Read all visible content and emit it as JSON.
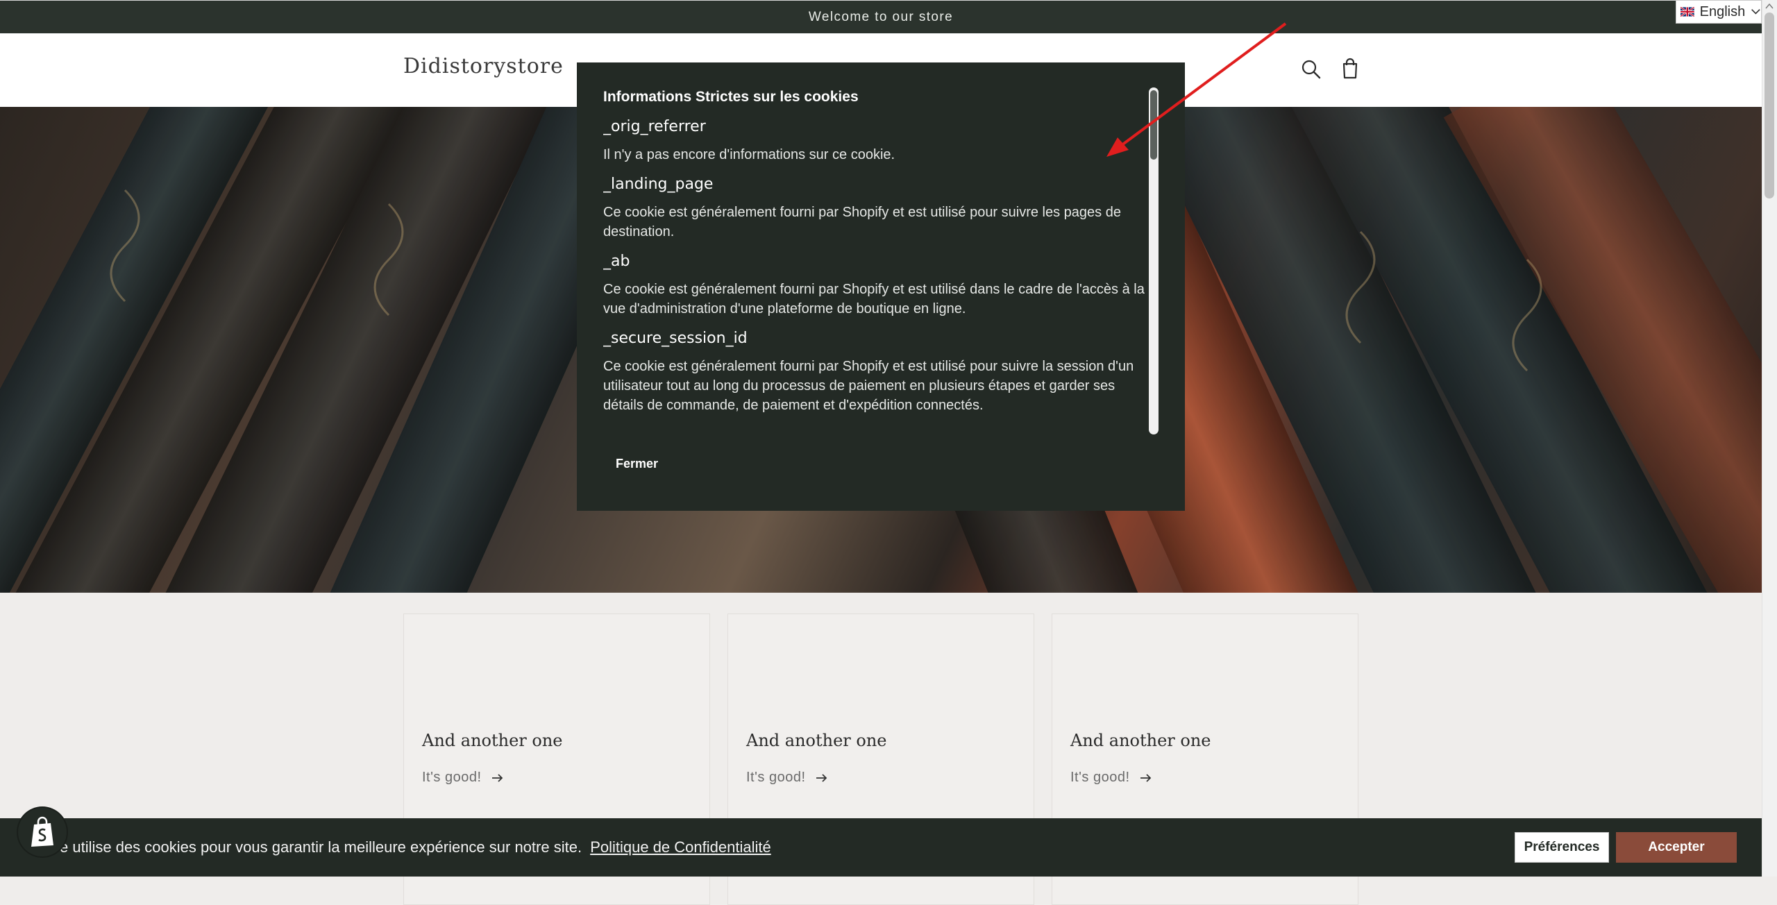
{
  "announcement": {
    "text": "Welcome to our store"
  },
  "language": {
    "selected": "English",
    "icon": "uk-flag-icon"
  },
  "header": {
    "logo": "Didistorystore",
    "icons": [
      "search-icon",
      "cart-icon"
    ]
  },
  "hero": {
    "description": "Background of antique leather book spines"
  },
  "cards": [
    {
      "title": "And another one",
      "link": "It's good!"
    },
    {
      "title": "And another one",
      "link": "It's good!"
    },
    {
      "title": "And another one",
      "link": "It's good!"
    }
  ],
  "modal": {
    "title": "Informations Strictes sur les cookies",
    "cookies": [
      {
        "name": "_orig_referrer",
        "description": "Il n'y a pas encore d'informations sur ce cookie."
      },
      {
        "name": "_landing_page",
        "description": "Ce cookie est généralement fourni par Shopify et est utilisé pour suivre les pages de destination."
      },
      {
        "name": "_ab",
        "description": "Ce cookie est généralement fourni par Shopify et est utilisé dans le cadre de l'accès à la vue d'administration d'une plateforme de boutique en ligne."
      },
      {
        "name": "_secure_session_id",
        "description": "Ce cookie est généralement fourni par Shopify et est utilisé pour suivre la session d'un utilisateur tout au long du processus de paiement en plusieurs étapes et garder ses détails de commande, de paiement et d'expédition connectés."
      }
    ],
    "close_label": "Fermer"
  },
  "cookie_bar": {
    "text": "e utilise des cookies pour vous garantir la meilleure expérience sur notre site.",
    "policy_link": "Politique de Confidentialité",
    "preferences_label": "Préférences",
    "accept_label": "Accepter"
  },
  "colors": {
    "dark_green": "#232a25",
    "announcement": "#2b332d",
    "accept": "#8a4b3a",
    "annotation_arrow": "#e01e1e"
  }
}
